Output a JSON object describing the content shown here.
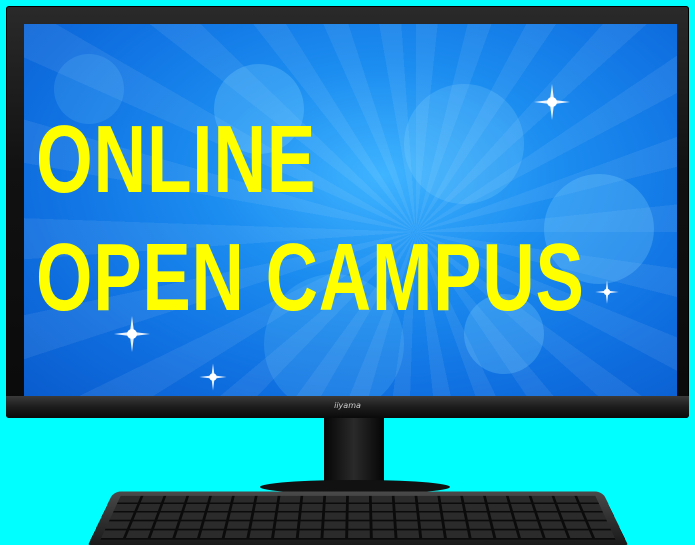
{
  "screen": {
    "headline_line1": "ONLINE",
    "headline_line2": "OPEN CAMPUS"
  },
  "monitor": {
    "brand": "iiyama"
  },
  "colors": {
    "background": "#00ffff",
    "screen_blue": "#1b8cf0",
    "headline_yellow": "#ffff00",
    "bezel": "#111111"
  }
}
